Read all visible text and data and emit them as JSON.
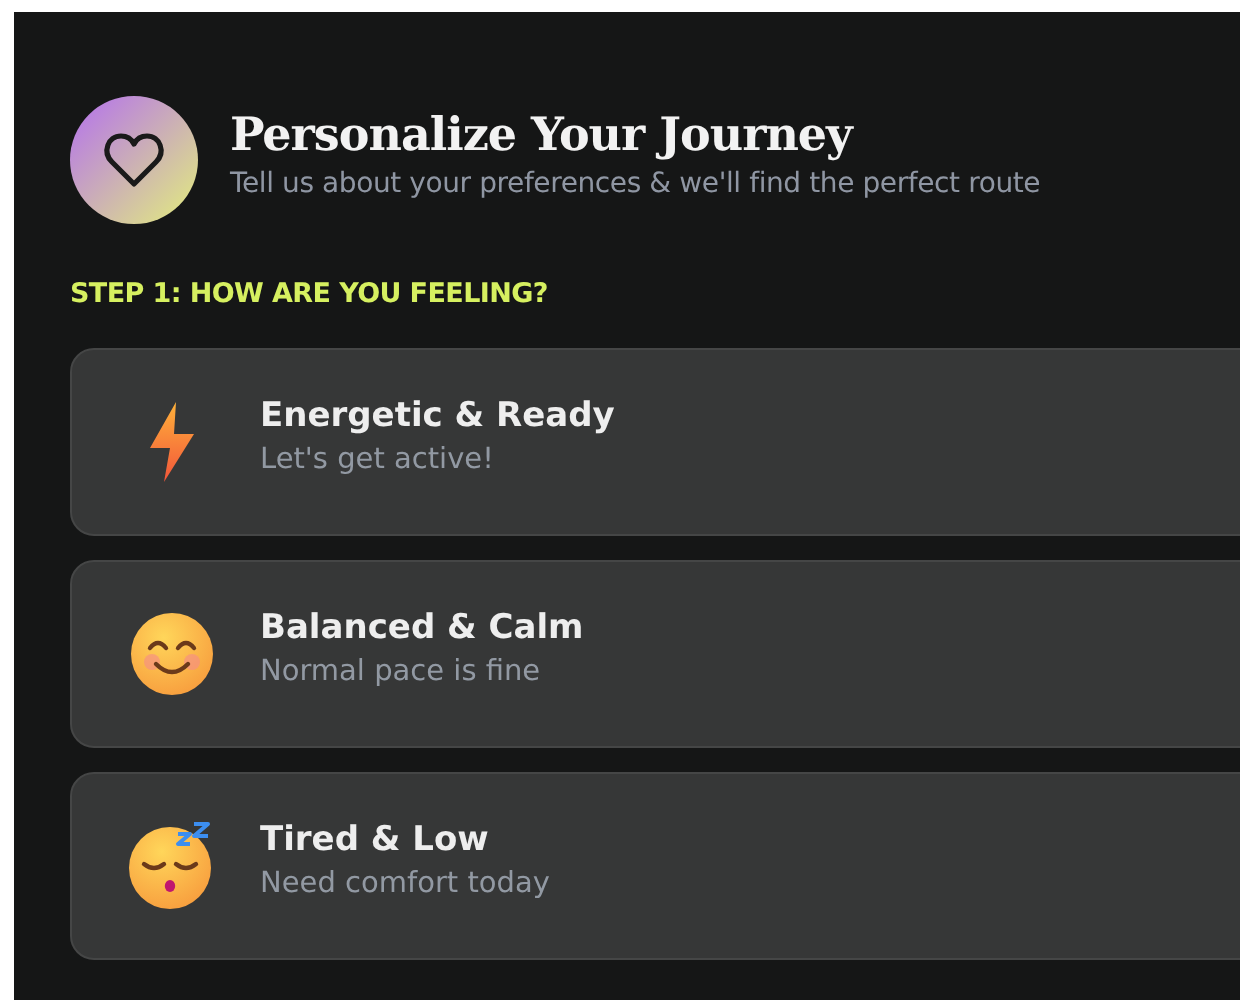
{
  "header": {
    "title": "Personalize Your Journey",
    "subtitle": "Tell us about your preferences & we'll find the perfect route"
  },
  "step_label": "STEP 1: HOW ARE YOU FEELING?",
  "options": [
    {
      "kind": "bolt",
      "title": "Energetic & Ready",
      "subtitle": "Let's get active!"
    },
    {
      "kind": "smile",
      "title": "Balanced & Calm",
      "subtitle": "Normal pace is fine"
    },
    {
      "kind": "sleepy",
      "title": "Tired & Low",
      "subtitle": "Need comfort today"
    }
  ]
}
